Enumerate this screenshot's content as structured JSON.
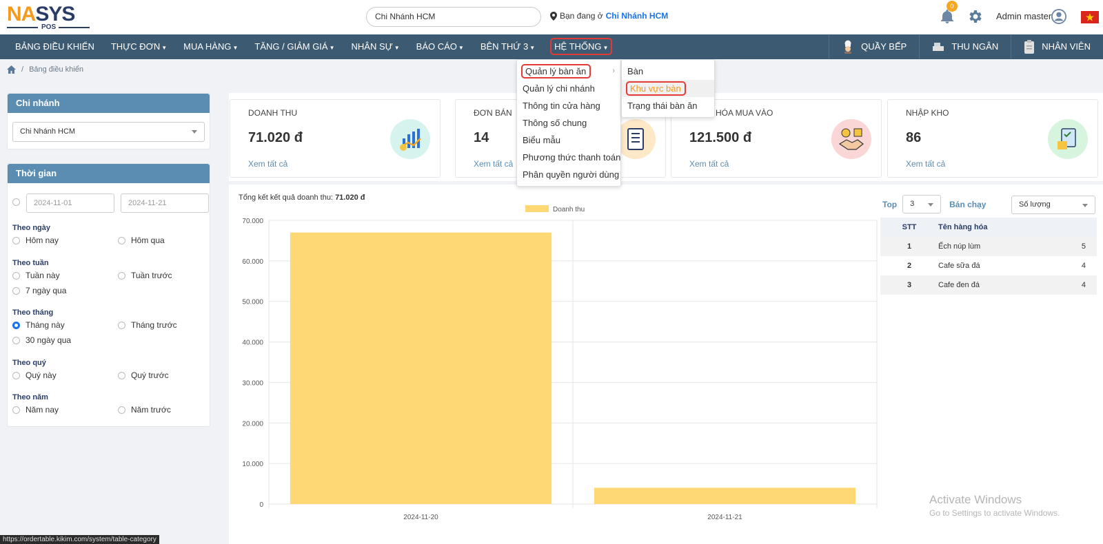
{
  "header": {
    "logo_na": "NA",
    "logo_sys": "SYS",
    "logo_pos": "POS",
    "branch_search_value": "Chi Nhánh HCM",
    "location_prefix": "Bạn đang ở",
    "location_branch": "Chi Nhánh HCM",
    "notification_count": "0",
    "user_name": "Admin master"
  },
  "nav": {
    "items": [
      {
        "label": "BẢNG ĐIỀU KHIỂN",
        "caret": false
      },
      {
        "label": "THỰC ĐƠN",
        "caret": true
      },
      {
        "label": "MUA HÀNG",
        "caret": true
      },
      {
        "label": "TĂNG / GIẢM GIÁ",
        "caret": true
      },
      {
        "label": "NHÂN SỰ",
        "caret": true
      },
      {
        "label": "BÁO CÁO",
        "caret": true
      },
      {
        "label": "BÊN THỨ 3",
        "caret": true
      },
      {
        "label": "HỆ THỐNG",
        "caret": true
      }
    ],
    "right": [
      {
        "label": "QUẦY BẾP",
        "icon": "chef-icon"
      },
      {
        "label": "THU NGÂN",
        "icon": "cashier-icon"
      },
      {
        "label": "NHÂN VIÊN",
        "icon": "clipboard-icon"
      }
    ]
  },
  "breadcrumb": {
    "current": "Bảng điều khiển"
  },
  "sidebar": {
    "branch_title": "Chi nhánh",
    "branch_value": "Chi Nhánh HCM",
    "time_title": "Thời gian",
    "date_from": "2024-11-01",
    "date_to": "2024-11-21",
    "groups": [
      {
        "label": "Theo ngày",
        "options": [
          "Hôm nay",
          "Hôm qua"
        ]
      },
      {
        "label": "Theo tuần",
        "options": [
          "Tuần này",
          "Tuần trước",
          "7 ngày qua"
        ]
      },
      {
        "label": "Theo tháng",
        "options": [
          "Tháng này",
          "Tháng trước",
          "30 ngày qua"
        ]
      },
      {
        "label": "Theo quý",
        "options": [
          "Quý này",
          "Quý trước"
        ]
      },
      {
        "label": "Theo năm",
        "options": [
          "Năm nay",
          "Năm trước"
        ]
      }
    ],
    "selected_option": "Tháng này"
  },
  "stats": [
    {
      "title": "DOANH THU",
      "value": "71.020 đ",
      "link": "Xem tất cả",
      "icon": "chart-growth-icon",
      "bg": "#d6f3ee"
    },
    {
      "title": "ĐƠN BÁN",
      "value": "14",
      "link": "Xem tất cả",
      "icon": "clipboard-list-icon",
      "bg": "#fde8c8"
    },
    {
      "title": "HÀNG HÓA MUA VÀO",
      "value": "121.500 đ",
      "link": "Xem tất cả",
      "icon": "handshake-icon",
      "bg": "#fbd6d6"
    },
    {
      "title": "NHẬP KHO",
      "value": "86",
      "link": "Xem tất cả",
      "icon": "warehouse-checklist-icon",
      "bg": "#d7f4df"
    }
  ],
  "chart_summary": {
    "prefix": "Tổng kết kết quả doanh thu:",
    "value": "71.020 đ"
  },
  "chart_data": {
    "type": "bar",
    "categories": [
      "2024-11-20",
      "2024-11-21"
    ],
    "series": [
      {
        "name": "Doanh thu",
        "values": [
          67000,
          4020
        ],
        "color": "#fdd875"
      }
    ],
    "ylim": [
      0,
      70000
    ],
    "yticks": [
      "0",
      "10.000",
      "20.000",
      "30.000",
      "40.000",
      "50.000",
      "60.000",
      "70.000"
    ],
    "grid": true,
    "legend": "top-center"
  },
  "top_panel": {
    "top_label": "Top",
    "top_value": "3",
    "best_label": "Bán chạy",
    "sort_value": "Số lượng",
    "headers": [
      "STT",
      "Tên hàng hóa",
      ""
    ],
    "rows": [
      {
        "stt": "1",
        "name": "Ếch núp lùm",
        "qty": "5"
      },
      {
        "stt": "2",
        "name": "Cafe sữa đá",
        "qty": "4"
      },
      {
        "stt": "3",
        "name": "Cafe đen đá",
        "qty": "4"
      }
    ]
  },
  "menu_system": {
    "items": [
      "Quản lý bàn ăn",
      "Quản lý chi nhánh",
      "Thông tin cửa hàng",
      "Thông số chung",
      "Biểu mẫu",
      "Phương thức thanh toán",
      "Phân quyền người dùng"
    ]
  },
  "submenu_table": {
    "items": [
      "Bàn",
      "Khu vực bàn",
      "Trạng thái bàn ăn"
    ]
  },
  "watermark": {
    "line1": "Activate Windows",
    "line2": "Go to Settings to activate Windows."
  },
  "status_url": "https://ordertable.kikim.com/system/table-category",
  "colors": {
    "nav": "#3d5a73",
    "accent": "#5b8db3",
    "bar": "#fdd875",
    "highlight": "#e53935",
    "orange": "#f39a1f"
  }
}
